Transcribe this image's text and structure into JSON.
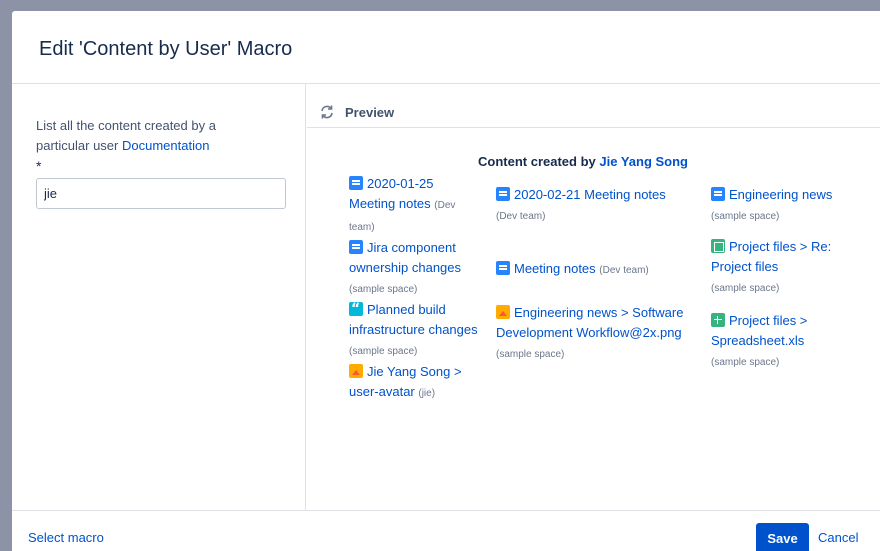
{
  "dialog": {
    "title": "Edit 'Content by User' Macro"
  },
  "left": {
    "description": "List all the content created by a particular user",
    "documentation_link": "Documentation",
    "required_marker": "*",
    "input_value": "jie"
  },
  "preview": {
    "label": "Preview",
    "heading_prefix": "Content created by",
    "user_name": "Jie Yang Song",
    "columns": [
      [
        {
          "icon": "page-icon",
          "title": "2020-01-25 Meeting notes",
          "space": "(Dev team)"
        },
        {
          "icon": "page-icon",
          "title": "Jira component ownership changes",
          "space": "(sample space)"
        },
        {
          "icon": "blog-icon",
          "title": "Planned build infrastructure changes",
          "space": "(sample space)"
        },
        {
          "icon": "image-icon",
          "title": "Jie Yang Song > user-avatar",
          "space": "(jie)"
        }
      ],
      [
        {
          "icon": "page-icon",
          "title": "2020-02-21 Meeting notes",
          "space": "(Dev team)"
        },
        {
          "icon": "page-icon",
          "title": "Meeting notes",
          "space": "(Dev team)"
        },
        {
          "icon": "image-icon",
          "title": "Engineering news > Software Development Workflow@2x.png",
          "space": "(sample space)"
        }
      ],
      [
        {
          "icon": "page-icon",
          "title": "Engineering news",
          "space": "(sample space)"
        },
        {
          "icon": "file-icon",
          "title": "Project files > Re: Project files",
          "space": "(sample space)"
        },
        {
          "icon": "spreadsheet-icon",
          "title": "Project files > Spreadsheet.xls",
          "space": "(sample space)"
        }
      ]
    ]
  },
  "footer": {
    "select_macro": "Select macro",
    "save": "Save",
    "cancel": "Cancel"
  },
  "colors": {
    "primary": "#0052cc",
    "overlay": "#8c93a6"
  }
}
